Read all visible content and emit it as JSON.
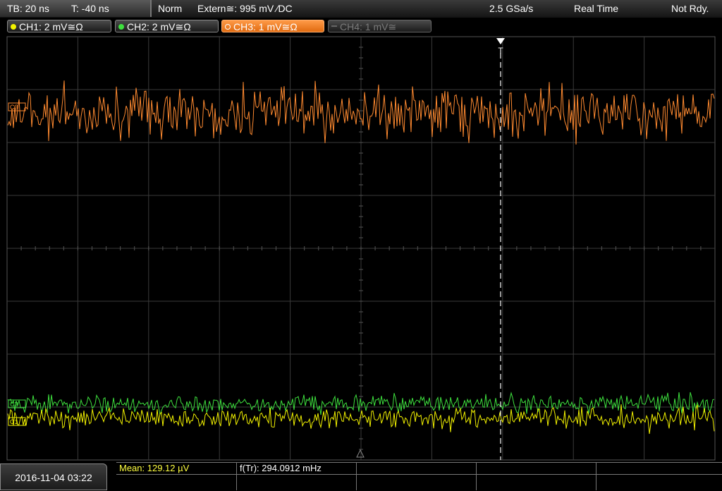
{
  "header": {
    "timebase": "TB: 20 ns",
    "trigger_time": "T: -40 ns",
    "mode": "Norm",
    "trigger_source": "Extern≅: 995 mV ∕DC",
    "sample_rate": "2.5 GSa/s",
    "acquisition": "Real Time",
    "status": "Not Rdy."
  },
  "channels": [
    {
      "label": "CH1: 2 mV≅Ω",
      "color": "#f2f200",
      "active": true
    },
    {
      "label": "CH2: 2 mV≅Ω",
      "color": "#3ee03e",
      "active": true
    },
    {
      "label": "CH3: 1 mV≅Ω",
      "color": "#ff8a30",
      "active": true,
      "selected": true
    },
    {
      "label": "CH4: 1 mV≅",
      "color": "#777777",
      "active": false
    }
  ],
  "markers": {
    "ch3": "C3",
    "ch2": "C2",
    "ch1": "C1",
    "trigger": "T"
  },
  "footer": {
    "datetime": "2016-11-04 03:22",
    "mean": "Mean: 129.12 µV",
    "freq": "f(Tr): 294.0912 mHz"
  },
  "colors": {
    "ch1": "#f2f200",
    "ch2": "#3ee03e",
    "ch3": "#ff8a30",
    "grid": "#3a3a3a",
    "mean_text": "#ffff40"
  }
}
